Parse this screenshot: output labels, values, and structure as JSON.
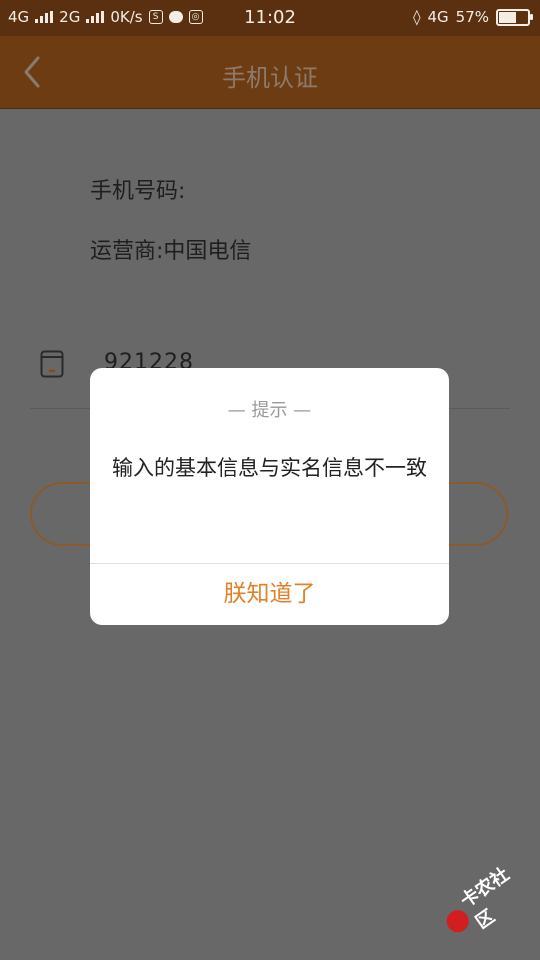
{
  "status_bar": {
    "network1": "4G",
    "network2": "2G",
    "speed": "0K/s",
    "time": "11:02",
    "net_right": "4G",
    "battery": "57%",
    "battery_fraction": 0.57
  },
  "nav": {
    "title": "手机认证"
  },
  "form": {
    "phone_label": "手机号码:",
    "carrier_label": "运营商:中国电信",
    "code_value": "921228"
  },
  "dialog": {
    "title": "— 提示 —",
    "message": "输入的基本信息与实名信息不一致",
    "confirm": "朕知道了"
  },
  "watermark": {
    "text": "卡农社区"
  },
  "colors": {
    "accent": "#e0802a",
    "navbar": "#6e3c13"
  }
}
